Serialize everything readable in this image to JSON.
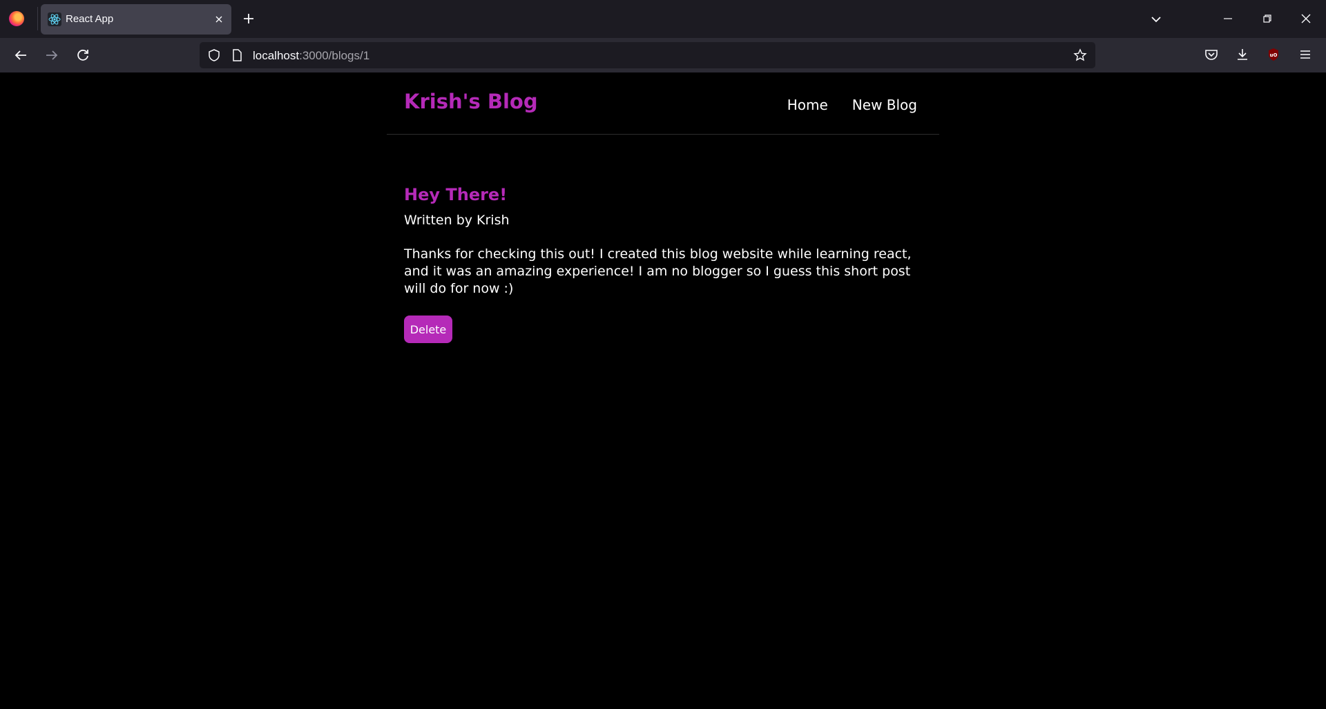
{
  "browser": {
    "tab_title": "React App",
    "url_host": "localhost",
    "url_path": ":3000/blogs/1"
  },
  "site": {
    "title": "Krish's Blog",
    "nav": {
      "home": "Home",
      "new_blog": "New Blog"
    }
  },
  "blog": {
    "title": "Hey There!",
    "author": "Written by Krish",
    "body": "Thanks for checking this out! I created this blog website while learning react, and it was an amazing experience! I am no blogger so I guess this short post will do for now :)",
    "delete_label": "Delete"
  },
  "colors": {
    "accent": "#b52ab8",
    "background": "#000000",
    "text": "#ffffff"
  }
}
